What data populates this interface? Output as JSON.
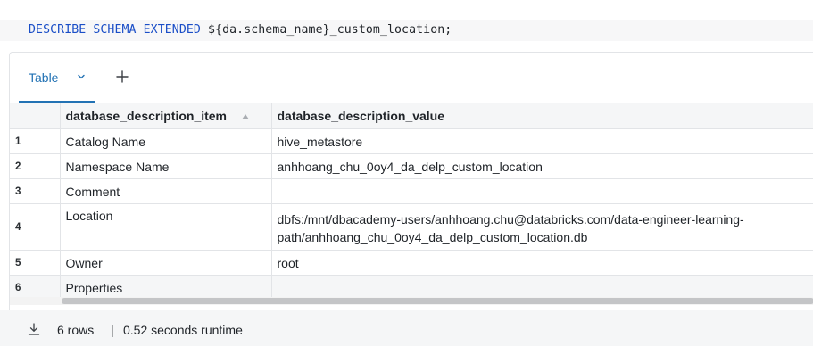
{
  "code": {
    "keywords": "DESCRIBE SCHEMA EXTENDED",
    "rest": " ${da.schema_name}_custom_location;"
  },
  "result_tabs": {
    "active_label": "Table",
    "add_label": "+"
  },
  "table": {
    "columns": [
      "database_description_item",
      "database_description_value"
    ],
    "rows": [
      {
        "index": "1",
        "item": "Catalog Name",
        "value": "hive_metastore"
      },
      {
        "index": "2",
        "item": "Namespace Name",
        "value": "anhhoang_chu_0oy4_da_delp_custom_location"
      },
      {
        "index": "3",
        "item": "Comment",
        "value": ""
      },
      {
        "index": "4",
        "item": "Location",
        "value": "dbfs:/mnt/dbacademy-users/anhhoang.chu@databricks.com/data-engineer-learning-path/anhhoang_chu_0oy4_da_delp_custom_location.db"
      },
      {
        "index": "5",
        "item": "Owner",
        "value": "root"
      },
      {
        "index": "6",
        "item": "Properties",
        "value": ""
      }
    ]
  },
  "footer": {
    "rows_count": "6 rows",
    "separator": "|",
    "runtime": "0.52 seconds runtime"
  },
  "colors": {
    "accent": "#2272b4",
    "keyword": "#1a4ec7"
  }
}
